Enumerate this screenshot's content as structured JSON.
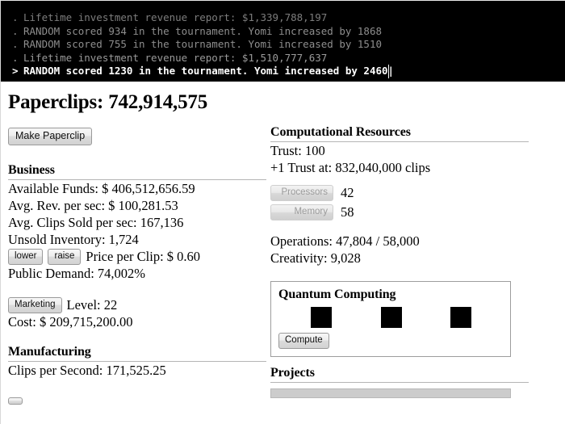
{
  "console": {
    "lines": [
      {
        "marker": ".",
        "text": "Lifetime investment revenue report: $1,339,788,197",
        "current": false
      },
      {
        "marker": ".",
        "text": "RANDOM scored 934 in the tournament. Yomi increased by 1868",
        "current": false
      },
      {
        "marker": ".",
        "text": "RANDOM scored 755 in the tournament. Yomi increased by 1510",
        "current": false
      },
      {
        "marker": ".",
        "text": "Lifetime investment revenue report: $1,510,777,637",
        "current": false
      },
      {
        "marker": ">",
        "text": "RANDOM scored 1230 in the tournament. Yomi increased by 2460",
        "current": true
      }
    ]
  },
  "header": {
    "title": "Paperclips: 742,914,575",
    "make_paperclip_label": "Make Paperclip"
  },
  "business": {
    "heading": "Business",
    "available_funds": "Available Funds: $ 406,512,656.59",
    "avg_rev_per_sec": "Avg. Rev. per sec: $ 100,281.53",
    "avg_clips_sold_per_sec": "Avg. Clips Sold per sec: 167,136",
    "unsold_inventory": "Unsold Inventory: 1,724",
    "lower_label": "lower",
    "raise_label": "raise",
    "price_per_clip": "Price per Clip: $ 0.60",
    "public_demand": "Public Demand: 74,002%",
    "marketing_label": "Marketing",
    "marketing_level": "Level: 22",
    "marketing_cost": "Cost: $ 209,715,200.00"
  },
  "manufacturing": {
    "heading": "Manufacturing",
    "clips_per_second": "Clips per Second: 171,525.25"
  },
  "computational_resources": {
    "heading": "Computational Resources",
    "trust": "Trust: 100",
    "next_trust": "+1 Trust at: 832,040,000 clips",
    "processors_label": "Processors",
    "processors_value": "42",
    "memory_label": "Memory",
    "memory_value": "58",
    "operations": "Operations: 47,804 / 58,000",
    "creativity": "Creativity: 9,028"
  },
  "quantum": {
    "heading": "Quantum Computing",
    "compute_label": "Compute",
    "chips": [
      "chip-0",
      "chip-1",
      "chip-2"
    ]
  },
  "projects": {
    "heading": "Projects"
  }
}
